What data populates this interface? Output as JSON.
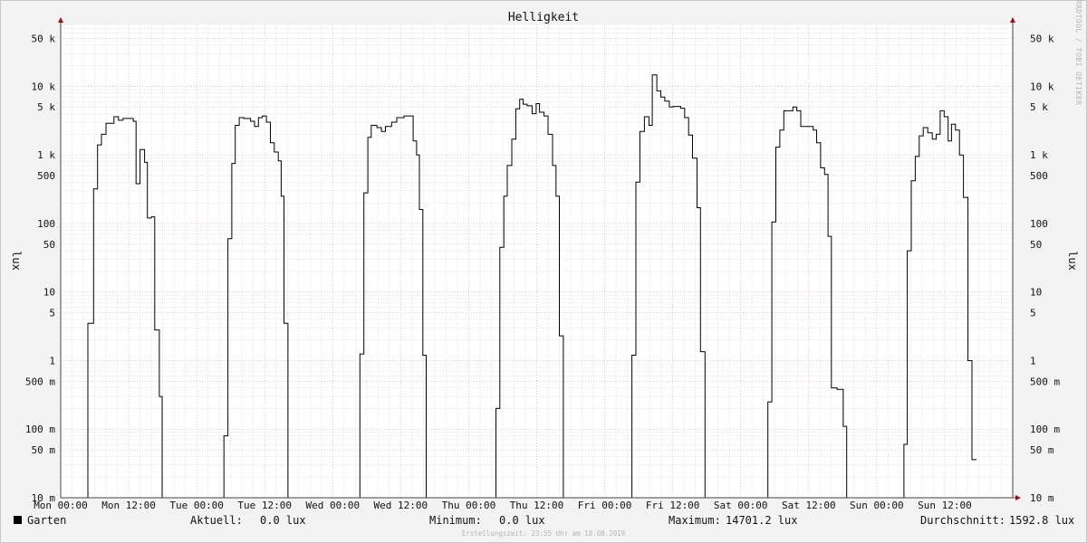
{
  "chart_data": {
    "type": "line",
    "title": "Helligkeit",
    "ylabel": "lux",
    "yscale": "log",
    "ylim": [
      0.01,
      80000
    ],
    "y_ticks": [
      {
        "value": 0.01,
        "label": "10 m"
      },
      {
        "value": 0.05,
        "label": "50 m"
      },
      {
        "value": 0.1,
        "label": "100 m"
      },
      {
        "value": 0.5,
        "label": "500 m"
      },
      {
        "value": 1,
        "label": "1"
      },
      {
        "value": 5,
        "label": "5"
      },
      {
        "value": 10,
        "label": "10"
      },
      {
        "value": 50,
        "label": "50"
      },
      {
        "value": 100,
        "label": "100"
      },
      {
        "value": 500,
        "label": "500"
      },
      {
        "value": 1000,
        "label": "1 k"
      },
      {
        "value": 5000,
        "label": "5 k"
      },
      {
        "value": 10000,
        "label": "10 k"
      },
      {
        "value": 50000,
        "label": "50 k"
      }
    ],
    "xlim": [
      0,
      168
    ],
    "x_ticks": [
      {
        "value": 0,
        "label": "Mon 00:00"
      },
      {
        "value": 12,
        "label": "Mon 12:00"
      },
      {
        "value": 24,
        "label": "Tue 00:00"
      },
      {
        "value": 36,
        "label": "Tue 12:00"
      },
      {
        "value": 48,
        "label": "Wed 00:00"
      },
      {
        "value": 60,
        "label": "Wed 12:00"
      },
      {
        "value": 72,
        "label": "Thu 00:00"
      },
      {
        "value": 84,
        "label": "Thu 12:00"
      },
      {
        "value": 96,
        "label": "Fri 00:00"
      },
      {
        "value": 108,
        "label": "Fri 12:00"
      },
      {
        "value": 120,
        "label": "Sat 00:00"
      },
      {
        "value": 132,
        "label": "Sat 12:00"
      },
      {
        "value": 144,
        "label": "Sun 00:00"
      },
      {
        "value": 156,
        "label": "Sun 12:00"
      }
    ],
    "grid": true,
    "series": [
      {
        "name": "Garten",
        "color": "#000000",
        "step": true,
        "points": [
          [
            0,
            0.01
          ],
          [
            4.8,
            0.01
          ],
          [
            4.8,
            3.5
          ],
          [
            5.8,
            3.5
          ],
          [
            5.8,
            320
          ],
          [
            6.5,
            320
          ],
          [
            6.5,
            1400
          ],
          [
            7.2,
            1400
          ],
          [
            7.2,
            2000
          ],
          [
            8.0,
            2000
          ],
          [
            8.0,
            2900
          ],
          [
            9.4,
            2900
          ],
          [
            9.4,
            3600
          ],
          [
            10.2,
            3600
          ],
          [
            10.2,
            3200
          ],
          [
            11.0,
            3200
          ],
          [
            11.0,
            3400
          ],
          [
            12.8,
            3400
          ],
          [
            12.8,
            3100
          ],
          [
            13.3,
            3100
          ],
          [
            13.3,
            380
          ],
          [
            14.0,
            380
          ],
          [
            14.0,
            1200
          ],
          [
            14.8,
            1200
          ],
          [
            14.8,
            780
          ],
          [
            15.3,
            780
          ],
          [
            15.3,
            120
          ],
          [
            16.0,
            120
          ],
          [
            16.0,
            125
          ],
          [
            16.6,
            125
          ],
          [
            16.6,
            2.8
          ],
          [
            17.4,
            2.8
          ],
          [
            17.4,
            0.3
          ],
          [
            17.9,
            0.3
          ],
          [
            17.9,
            0.01
          ],
          [
            28.8,
            0.01
          ],
          [
            28.8,
            0.08
          ],
          [
            29.5,
            0.08
          ],
          [
            29.5,
            60
          ],
          [
            30.2,
            60
          ],
          [
            30.2,
            750
          ],
          [
            30.8,
            750
          ],
          [
            30.8,
            2700
          ],
          [
            31.5,
            2700
          ],
          [
            31.5,
            3500
          ],
          [
            32.3,
            3500
          ],
          [
            32.3,
            3400
          ],
          [
            33.5,
            3400
          ],
          [
            33.5,
            3100
          ],
          [
            34.2,
            3100
          ],
          [
            34.2,
            2600
          ],
          [
            34.9,
            2600
          ],
          [
            34.9,
            3500
          ],
          [
            35.6,
            3500
          ],
          [
            35.6,
            3700
          ],
          [
            36.3,
            3700
          ],
          [
            36.3,
            3000
          ],
          [
            37.0,
            3000
          ],
          [
            37.0,
            1500
          ],
          [
            37.7,
            1500
          ],
          [
            37.7,
            1100
          ],
          [
            38.4,
            1100
          ],
          [
            38.4,
            820
          ],
          [
            38.9,
            820
          ],
          [
            38.9,
            250
          ],
          [
            39.4,
            250
          ],
          [
            39.4,
            3.5
          ],
          [
            40.1,
            3.5
          ],
          [
            40.1,
            0.01
          ],
          [
            52.8,
            0.01
          ],
          [
            52.8,
            1.25
          ],
          [
            53.5,
            1.25
          ],
          [
            53.5,
            280
          ],
          [
            54.2,
            280
          ],
          [
            54.2,
            1800
          ],
          [
            54.8,
            1800
          ],
          [
            54.8,
            2700
          ],
          [
            55.8,
            2700
          ],
          [
            55.8,
            2500
          ],
          [
            56.6,
            2500
          ],
          [
            56.6,
            2200
          ],
          [
            57.3,
            2200
          ],
          [
            57.3,
            2600
          ],
          [
            58.4,
            2600
          ],
          [
            58.4,
            3000
          ],
          [
            59.3,
            3000
          ],
          [
            59.3,
            3500
          ],
          [
            60.6,
            3500
          ],
          [
            60.6,
            3700
          ],
          [
            62.2,
            3700
          ],
          [
            62.2,
            1600
          ],
          [
            62.8,
            1600
          ],
          [
            62.8,
            1000
          ],
          [
            63.3,
            1000
          ],
          [
            63.3,
            160
          ],
          [
            63.9,
            160
          ],
          [
            63.9,
            1.2
          ],
          [
            64.5,
            1.2
          ],
          [
            64.5,
            0.01
          ],
          [
            76.8,
            0.01
          ],
          [
            76.8,
            0.2
          ],
          [
            77.5,
            0.2
          ],
          [
            77.5,
            45
          ],
          [
            78.2,
            45
          ],
          [
            78.2,
            250
          ],
          [
            78.8,
            250
          ],
          [
            78.8,
            700
          ],
          [
            79.6,
            700
          ],
          [
            79.6,
            1700
          ],
          [
            80.3,
            1700
          ],
          [
            80.3,
            4700
          ],
          [
            81.0,
            4700
          ],
          [
            81.0,
            6500
          ],
          [
            81.6,
            6500
          ],
          [
            81.6,
            5500
          ],
          [
            82.3,
            5500
          ],
          [
            82.3,
            5200
          ],
          [
            83.2,
            5200
          ],
          [
            83.2,
            4000
          ],
          [
            83.9,
            4000
          ],
          [
            83.9,
            5600
          ],
          [
            84.5,
            5600
          ],
          [
            84.5,
            4200
          ],
          [
            85.3,
            4200
          ],
          [
            85.3,
            3700
          ],
          [
            86.0,
            3700
          ],
          [
            86.0,
            2000
          ],
          [
            86.8,
            2000
          ],
          [
            86.8,
            700
          ],
          [
            87.4,
            700
          ],
          [
            87.4,
            250
          ],
          [
            88.0,
            250
          ],
          [
            88.0,
            2.3
          ],
          [
            88.7,
            2.3
          ],
          [
            88.7,
            0.01
          ],
          [
            100.8,
            0.01
          ],
          [
            100.8,
            1.2
          ],
          [
            101.5,
            1.2
          ],
          [
            101.5,
            400
          ],
          [
            102.2,
            400
          ],
          [
            102.2,
            2200
          ],
          [
            103.0,
            2200
          ],
          [
            103.0,
            3600
          ],
          [
            103.8,
            3600
          ],
          [
            103.8,
            2700
          ],
          [
            104.4,
            2700
          ],
          [
            104.4,
            14700
          ],
          [
            105.2,
            14700
          ],
          [
            105.2,
            8600
          ],
          [
            105.9,
            8600
          ],
          [
            105.9,
            7000
          ],
          [
            106.6,
            7000
          ],
          [
            106.6,
            6100
          ],
          [
            107.4,
            6100
          ],
          [
            107.4,
            5000
          ],
          [
            108.1,
            5000
          ],
          [
            108.1,
            5100
          ],
          [
            109.4,
            5100
          ],
          [
            109.4,
            4800
          ],
          [
            110.1,
            4800
          ],
          [
            110.1,
            3500
          ],
          [
            110.8,
            3500
          ],
          [
            110.8,
            1950
          ],
          [
            111.5,
            1950
          ],
          [
            111.5,
            900
          ],
          [
            112.3,
            900
          ],
          [
            112.3,
            170
          ],
          [
            112.9,
            170
          ],
          [
            112.9,
            1.35
          ],
          [
            113.7,
            1.35
          ],
          [
            113.7,
            0.01
          ],
          [
            124.8,
            0.01
          ],
          [
            124.8,
            0.25
          ],
          [
            125.5,
            0.25
          ],
          [
            125.5,
            105
          ],
          [
            126.2,
            105
          ],
          [
            126.2,
            1300
          ],
          [
            126.9,
            1300
          ],
          [
            126.9,
            2300
          ],
          [
            127.6,
            2300
          ],
          [
            127.6,
            4400
          ],
          [
            129.2,
            4400
          ],
          [
            129.2,
            5000
          ],
          [
            129.9,
            5000
          ],
          [
            129.9,
            4400
          ],
          [
            130.6,
            4400
          ],
          [
            130.6,
            2600
          ],
          [
            132.8,
            2600
          ],
          [
            132.8,
            2300
          ],
          [
            133.4,
            2300
          ],
          [
            133.4,
            1500
          ],
          [
            134.1,
            1500
          ],
          [
            134.1,
            650
          ],
          [
            134.8,
            650
          ],
          [
            134.8,
            520
          ],
          [
            135.4,
            520
          ],
          [
            135.4,
            65
          ],
          [
            136.0,
            65
          ],
          [
            136.0,
            0.4
          ],
          [
            137.0,
            0.4
          ],
          [
            137.0,
            0.38
          ],
          [
            138.1,
            0.38
          ],
          [
            138.1,
            0.11
          ],
          [
            138.7,
            0.11
          ],
          [
            138.7,
            0.01
          ],
          [
            148.8,
            0.01
          ],
          [
            148.8,
            0.06
          ],
          [
            149.4,
            0.06
          ],
          [
            149.4,
            40
          ],
          [
            150.1,
            40
          ],
          [
            150.1,
            420
          ],
          [
            150.8,
            420
          ],
          [
            150.8,
            950
          ],
          [
            151.5,
            950
          ],
          [
            151.5,
            1900
          ],
          [
            152.2,
            1900
          ],
          [
            152.2,
            2500
          ],
          [
            153.0,
            2500
          ],
          [
            153.0,
            2100
          ],
          [
            153.8,
            2100
          ],
          [
            153.8,
            1700
          ],
          [
            154.5,
            1700
          ],
          [
            154.5,
            2000
          ],
          [
            155.2,
            2000
          ],
          [
            155.2,
            4400
          ],
          [
            155.9,
            4400
          ],
          [
            155.9,
            3600
          ],
          [
            156.6,
            3600
          ],
          [
            156.6,
            1600
          ],
          [
            157.2,
            1600
          ],
          [
            157.2,
            2800
          ],
          [
            157.9,
            2800
          ],
          [
            157.9,
            2300
          ],
          [
            158.6,
            2300
          ],
          [
            158.6,
            1000
          ],
          [
            159.3,
            1000
          ],
          [
            159.3,
            240
          ],
          [
            160.1,
            240
          ],
          [
            160.1,
            1
          ],
          [
            160.8,
            1
          ],
          [
            160.8,
            0.036
          ],
          [
            161.6,
            0.036
          ]
        ]
      }
    ]
  },
  "side_text": "RRDTOOL / TOBI OETIKER",
  "legend": {
    "swatch_color": "#000000",
    "name": "Garten",
    "aktuell_label": "Aktuell:",
    "aktuell_value": "0.0 lux",
    "minimum_label": "Minimum:",
    "minimum_value": "0.0 lux",
    "maximum_label": "Maximum:",
    "maximum_value": "14701.2 lux",
    "avg_label": "Durchschnitt:",
    "avg_value": "1592.8 lux"
  },
  "footer": "Erstellungszeit: 23:55 Uhr am 18.08.2019"
}
